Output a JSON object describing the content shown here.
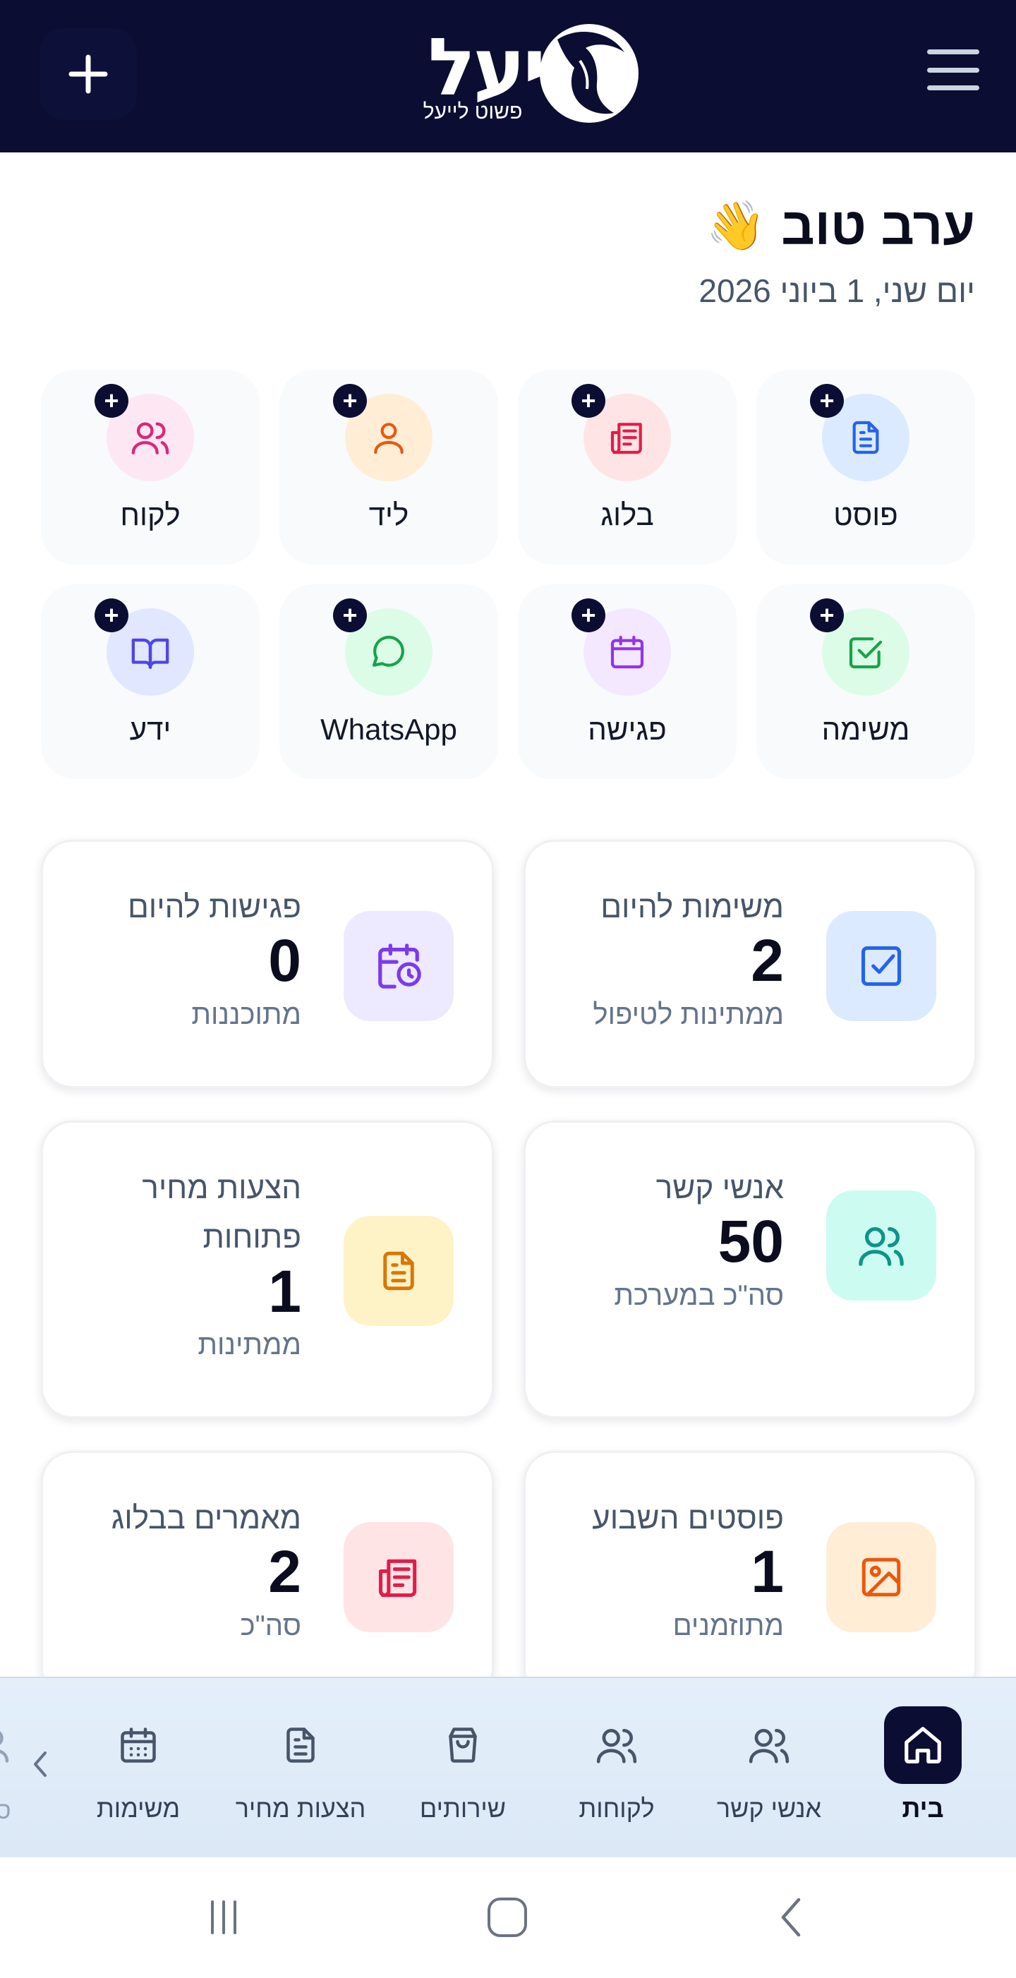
{
  "header": {
    "logo_text": "יעל",
    "logo_tagline": "פשוט לייעל",
    "plus_icon": "plus-icon",
    "menu_icon": "hamburger-menu-icon",
    "bg_color": "#0b0d33"
  },
  "greeting": {
    "title": "ערב טוב",
    "emoji": "👋",
    "date": "יום שני, 1 ביוני 2026"
  },
  "quick_actions": [
    {
      "label": "פוסט",
      "icon": "document-icon",
      "color": "#2563eb",
      "bg": "#dbeafe"
    },
    {
      "label": "בלוג",
      "icon": "newspaper-icon",
      "color": "#e11d48",
      "bg": "#ffe4e6"
    },
    {
      "label": "ליד",
      "icon": "user-icon",
      "color": "#ea580c",
      "bg": "#ffedd5"
    },
    {
      "label": "לקוח",
      "icon": "users-icon",
      "color": "#db2777",
      "bg": "#fce7f3"
    },
    {
      "label": "משימה",
      "icon": "check-square-icon",
      "color": "#16a34a",
      "bg": "#dcfce7"
    },
    {
      "label": "פגישה",
      "icon": "calendar-icon",
      "color": "#9333ea",
      "bg": "#f3e8ff"
    },
    {
      "label": "WhatsApp",
      "icon": "chat-bubble-icon",
      "color": "#16a34a",
      "bg": "#dcfce7"
    },
    {
      "label": "ידע",
      "icon": "book-icon",
      "color": "#4f46e5",
      "bg": "#e0e7ff"
    }
  ],
  "quick_action_badge": "+",
  "stats": [
    {
      "title": "משימות להיום",
      "value": "2",
      "subtitle": "ממתינות לטיפול",
      "icon": "check-square-icon",
      "color": "#2563eb",
      "bg": "#dbeafe"
    },
    {
      "title": "פגישות להיום",
      "value": "0",
      "subtitle": "מתוכננות",
      "icon": "calendar-clock-icon",
      "color": "#7c3aed",
      "bg": "#ede9fe"
    },
    {
      "title": "אנשי קשר",
      "value": "50",
      "subtitle": "סה\"כ במערכת",
      "icon": "users-icon",
      "color": "#0d9488",
      "bg": "#ccfbf1"
    },
    {
      "title": "הצעות מחיר פתוחות",
      "value": "1",
      "subtitle": "ממתינות",
      "icon": "document-icon",
      "color": "#d97706",
      "bg": "#fef3c7"
    },
    {
      "title": "פוסטים השבוע",
      "value": "1",
      "subtitle": "מתוזמנים",
      "icon": "image-icon",
      "color": "#ea580c",
      "bg": "#ffedd5"
    },
    {
      "title": "מאמרים בבלוג",
      "value": "2",
      "subtitle": "סה\"כ",
      "icon": "newspaper-icon",
      "color": "#e11d48",
      "bg": "#ffe4e6"
    }
  ],
  "bottom_nav": {
    "items": [
      {
        "label": "בית",
        "icon": "home-icon",
        "active": true
      },
      {
        "label": "אנשי קשר",
        "icon": "users-icon",
        "active": false
      },
      {
        "label": "לקוחות",
        "icon": "users-icon",
        "active": false
      },
      {
        "label": "שירותים",
        "icon": "shopping-bag-icon",
        "active": false
      },
      {
        "label": "הצעות מחיר",
        "icon": "document-icon",
        "active": false
      },
      {
        "label": "משימות",
        "icon": "calendar-icon",
        "active": false
      }
    ],
    "clipped_label": "סו"
  },
  "system_nav": {
    "recents_icon": "recents-icon",
    "home_icon": "home-outline-icon",
    "back_icon": "back-icon"
  }
}
